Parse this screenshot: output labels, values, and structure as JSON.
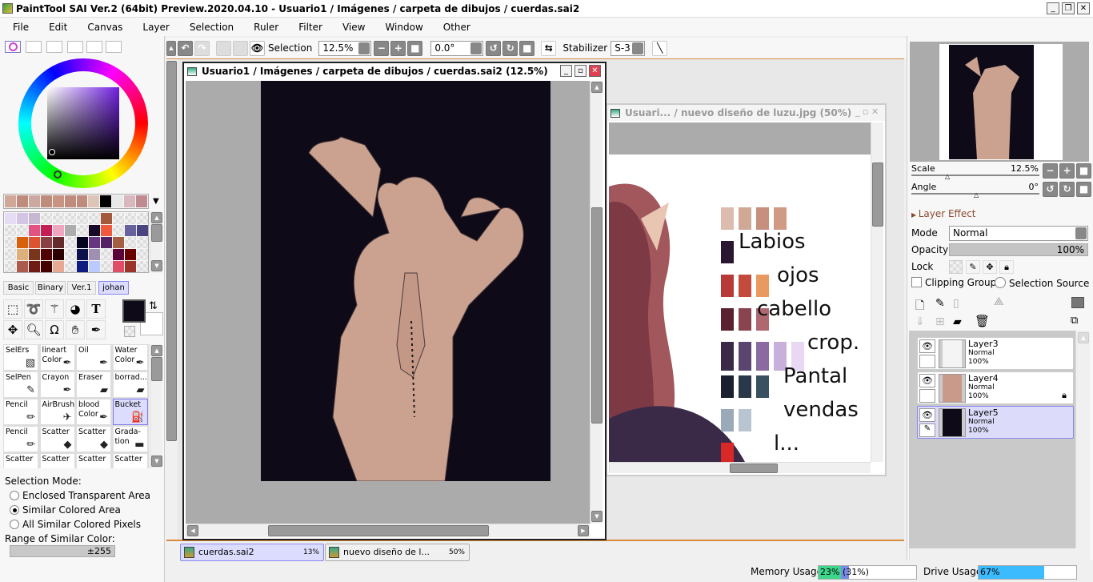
{
  "title": "PaintTool SAI Ver.2 (64bit) Preview.2020.04.10 - Usuario1 / Imágenes / carpeta de dibujos / cuerdas.sai2",
  "menu": [
    "File",
    "Edit",
    "Canvas",
    "Layer",
    "Selection",
    "Ruler",
    "Filter",
    "View",
    "Window",
    "Other"
  ],
  "palette_row": [
    "#cfa89a",
    "#bf8b7c",
    "#cba9a0",
    "#bf8b7b",
    "#c99383",
    "#bf8b7c",
    "#bf8b7c",
    "#ddc5b8",
    "#000000",
    "#e8e8e8",
    "#d9b8bd",
    "#bf8a90"
  ],
  "swatches": [
    [
      "#e6dcf3",
      "#d4c5e5",
      "#c7b8d2",
      null,
      null,
      null,
      null,
      null,
      "#a4583c",
      null,
      null,
      null
    ],
    [
      null,
      null,
      "#e0547f",
      "#c41f55",
      "#f1a6c0",
      "#adadad",
      null,
      "#170a26",
      "#f0593f",
      null,
      "#67629e",
      "#4a4582"
    ],
    [
      null,
      "#d6600b",
      "#dd5230",
      "#874144",
      "#652a2c",
      null,
      "#03031e",
      "#66377f",
      "#522265",
      "#a35e44",
      null,
      null
    ],
    [
      null,
      "#dbb07b",
      "#7a361c",
      "#4e0202",
      "#2c0000",
      null,
      "#0b124c",
      "#9f8fb1",
      null,
      "#5b0338",
      "#680002",
      null
    ],
    [
      null,
      "#ab5b4c",
      "#6f1d14",
      "#450000",
      "#e7a992",
      null,
      "#0d1c80",
      "#bdcaff",
      null,
      "#e04d67",
      "#9b342b",
      null
    ]
  ],
  "brush_set_tabs": [
    "Basic",
    "Binary",
    "Ver.1",
    "johan"
  ],
  "primary_color": "#0e0a18",
  "brushes": [
    {
      "name": "SelErs",
      "icon": "▧"
    },
    {
      "name": "lineart Color",
      "icon": "✒"
    },
    {
      "name": "Oil",
      "icon": "✒"
    },
    {
      "name": "Water Color",
      "icon": "✒"
    },
    {
      "name": "SelPen",
      "icon": "✎"
    },
    {
      "name": "Crayon",
      "icon": "✒"
    },
    {
      "name": "Eraser",
      "icon": "▰"
    },
    {
      "name": "borrad...",
      "icon": "▰"
    },
    {
      "name": "Pencil",
      "icon": "✏"
    },
    {
      "name": "AirBrush",
      "icon": "✈"
    },
    {
      "name": "blood Color",
      "icon": "✒"
    },
    {
      "name": "Bucket",
      "icon": "⛽",
      "selected": true
    },
    {
      "name": "Pencil",
      "icon": "✏"
    },
    {
      "name": "Scatter",
      "icon": "◆"
    },
    {
      "name": "Scatter",
      "icon": "◆"
    },
    {
      "name": "Grada- tion",
      "icon": "▬"
    },
    {
      "name": "Scatter",
      "icon": ""
    },
    {
      "name": "Scatter",
      "icon": ""
    },
    {
      "name": "Scatter",
      "icon": ""
    },
    {
      "name": "Scatter",
      "icon": ""
    }
  ],
  "selection_mode": {
    "label": "Selection Mode:",
    "options": [
      "Enclosed Transparent Area",
      "Similar Colored Area",
      "All Similar Colored Pixels"
    ],
    "selected": 1,
    "range_label": "Range of Similar Color:",
    "range_value": "±255"
  },
  "toolbar": {
    "selection_label": "Selection",
    "zoom": "12.5%",
    "angle": "0.0°",
    "stabilizer_label": "Stabilizer",
    "stabilizer": "S-3"
  },
  "window1": {
    "title": "Usuario1 / Imágenes / carpeta de dibujos / cuerdas.sai2 (12.5%)"
  },
  "window2": {
    "title": "Usuari... / nuevo diseño de luzu.jpg (50%)",
    "labels": [
      "Labios",
      "ojos",
      "cabello",
      "crop.",
      "Pantal",
      "vendas",
      "l..."
    ]
  },
  "navigator": {
    "scale_label": "Scale",
    "scale": "12.5%",
    "angle_label": "Angle",
    "angle": "0°"
  },
  "layer_effect": "Layer Effect",
  "layer_props": {
    "mode_label": "Mode",
    "mode": "Normal",
    "opacity_label": "Opacity",
    "opacity": "100%",
    "lock_label": "Lock",
    "clipping": "Clipping Group",
    "selection_source": "Selection Source"
  },
  "layers": [
    {
      "name": "Layer3",
      "mode": "Normal",
      "opacity": "100%",
      "locked": false,
      "selected": false,
      "thumb": "#f4f4f4"
    },
    {
      "name": "Layer4",
      "mode": "Normal",
      "opacity": "100%",
      "locked": true,
      "selected": false,
      "thumb": "#c99a8a"
    },
    {
      "name": "Layer5",
      "mode": "Normal",
      "opacity": "100%",
      "locked": false,
      "selected": true,
      "thumb": "#0e0a18"
    }
  ],
  "doc_tabs": [
    {
      "name": "cuerdas.sai2",
      "zoom": "13%"
    },
    {
      "name": "nuevo diseño de l...",
      "zoom": "50%"
    }
  ],
  "status": {
    "memory_label": "Memory Usage",
    "memory": "23% (31%)",
    "memory_pct": 23,
    "memory_pct2": 31,
    "drive_label": "Drive Usage",
    "drive": "67%",
    "drive_pct": 67
  }
}
